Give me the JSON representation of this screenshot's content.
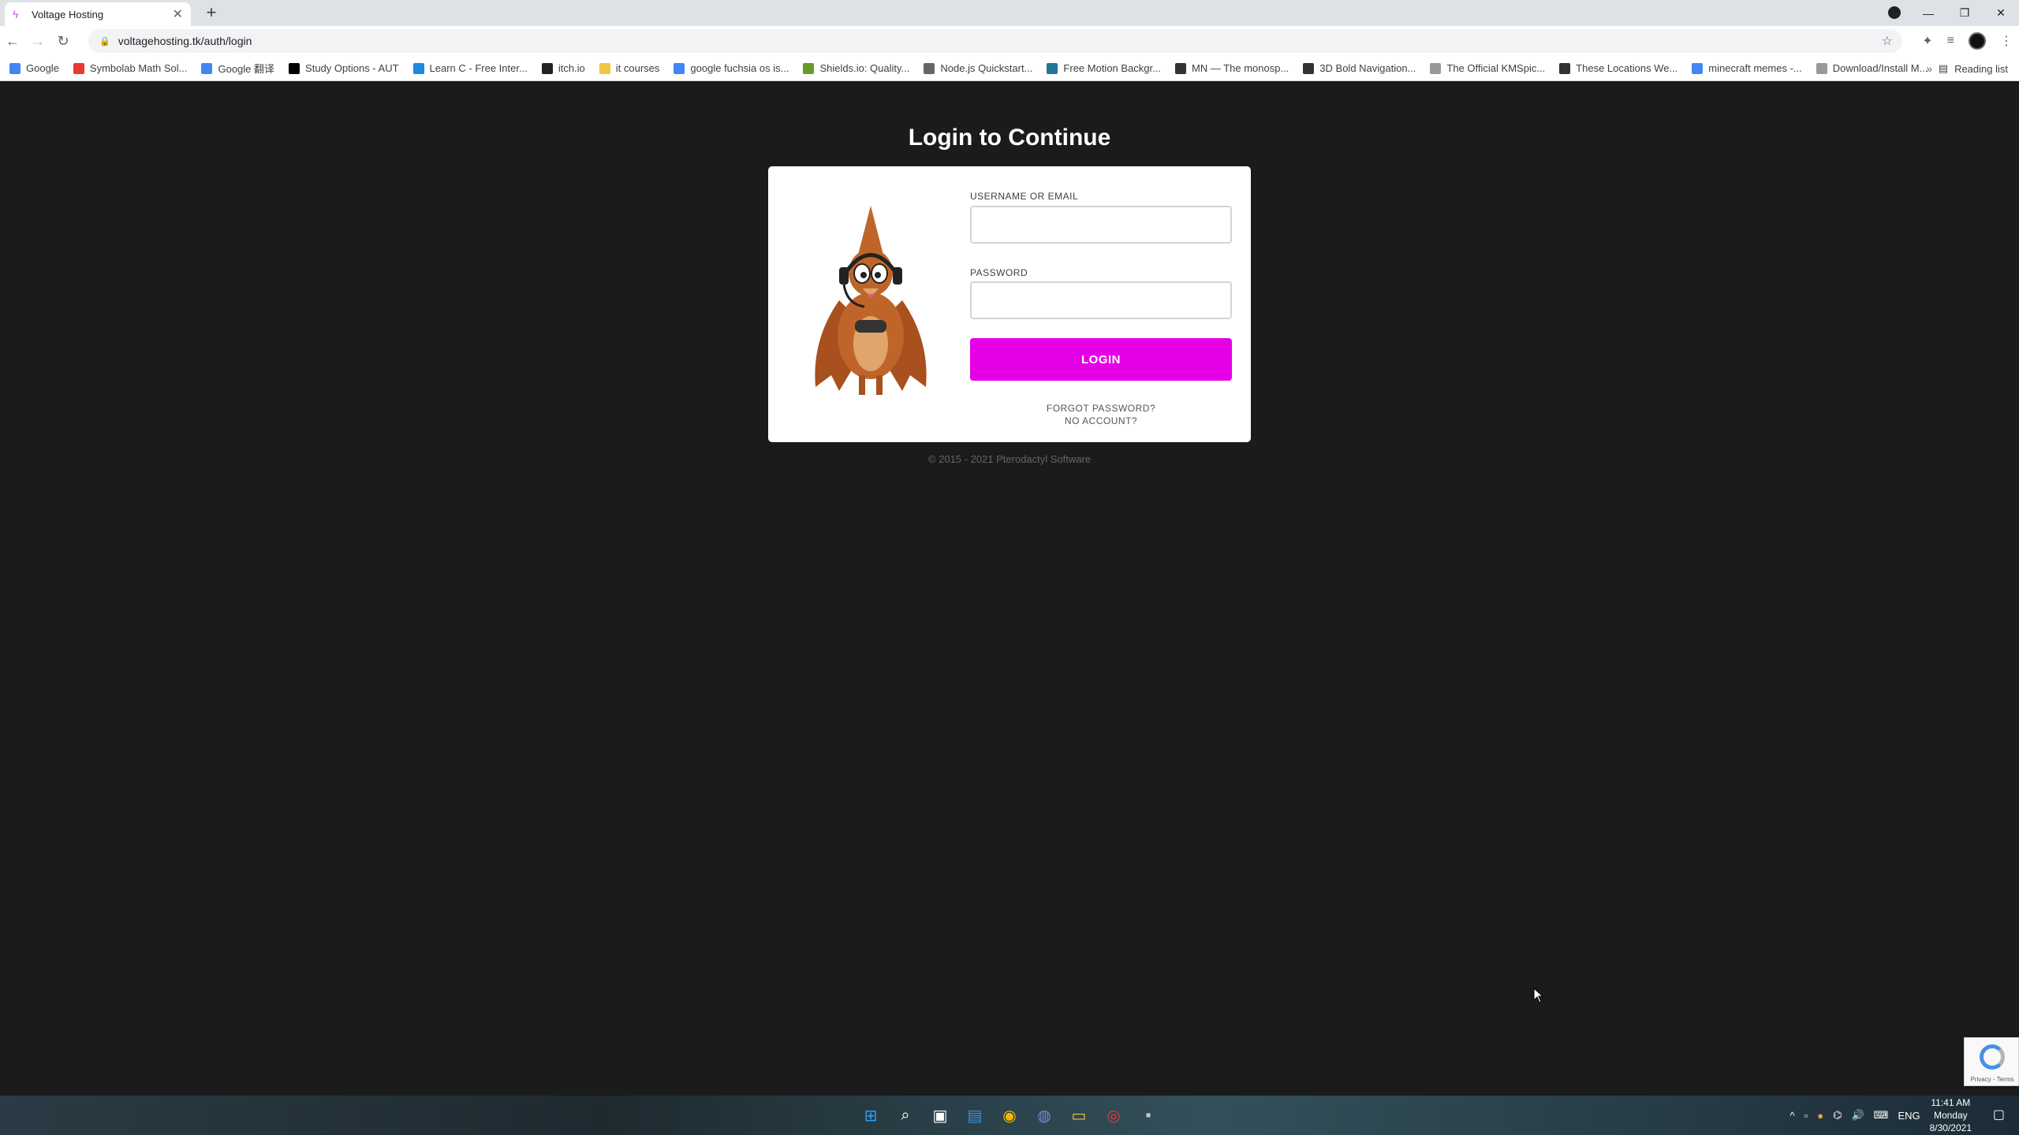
{
  "browser": {
    "tab_title": "Voltage Hosting",
    "tab_close": "✕",
    "new_tab": "+",
    "url": "voltagehosting.tk/auth/login",
    "reading_list": "Reading list",
    "bookmark_overflow": "»",
    "bookmarks": [
      {
        "label": "Google",
        "icon": "google-icon",
        "color": "#4285f4"
      },
      {
        "label": "Symbolab Math Sol...",
        "icon": "symbolab-icon",
        "color": "#e53935"
      },
      {
        "label": "Google 翻译",
        "icon": "google-translate-icon",
        "color": "#4285f4"
      },
      {
        "label": "Study Options - AUT",
        "icon": "aut-icon",
        "color": "#000000"
      },
      {
        "label": "Learn C - Free Inter...",
        "icon": "learn-c-icon",
        "color": "#1e88e5"
      },
      {
        "label": "itch.io",
        "icon": "itchio-icon",
        "color": "#222222"
      },
      {
        "label": "it courses",
        "icon": "folder-icon",
        "color": "#f4c542"
      },
      {
        "label": "google fuchsia os is...",
        "icon": "google-icon",
        "color": "#4285f4"
      },
      {
        "label": "Shields.io: Quality...",
        "icon": "shields-icon",
        "color": "#6a9a2a"
      },
      {
        "label": "Node.js Quickstart...",
        "icon": "code-icon",
        "color": "#666666"
      },
      {
        "label": "Free Motion Backgr...",
        "icon": "wordpress-icon",
        "color": "#21759b"
      },
      {
        "label": "MN — The monosp...",
        "icon": "mn-icon",
        "color": "#333333"
      },
      {
        "label": "3D Bold Navigation...",
        "icon": "gear-icon",
        "color": "#333333"
      },
      {
        "label": "The Official KMSpic...",
        "icon": "globe-icon",
        "color": "#999999"
      },
      {
        "label": "These Locations We...",
        "icon": "page-icon",
        "color": "#333333"
      },
      {
        "label": "minecraft memes -...",
        "icon": "google-icon",
        "color": "#4285f4"
      },
      {
        "label": "Download/Install M...",
        "icon": "globe-icon",
        "color": "#999999"
      }
    ]
  },
  "page": {
    "heading": "Login to Continue",
    "username_label": "USERNAME OR EMAIL",
    "password_label": "PASSWORD",
    "login_button": "LOGIN",
    "forgot_password": "FORGOT PASSWORD?",
    "no_account": "NO ACCOUNT?",
    "footer": "© 2015 - 2021 Pterodactyl Software",
    "accent_color": "#e600e6"
  },
  "recaptcha": {
    "text": "Privacy - Terms"
  },
  "taskbar": {
    "language": "ENG",
    "time": "11:41 AM",
    "day": "Monday",
    "date": "8/30/2021"
  }
}
